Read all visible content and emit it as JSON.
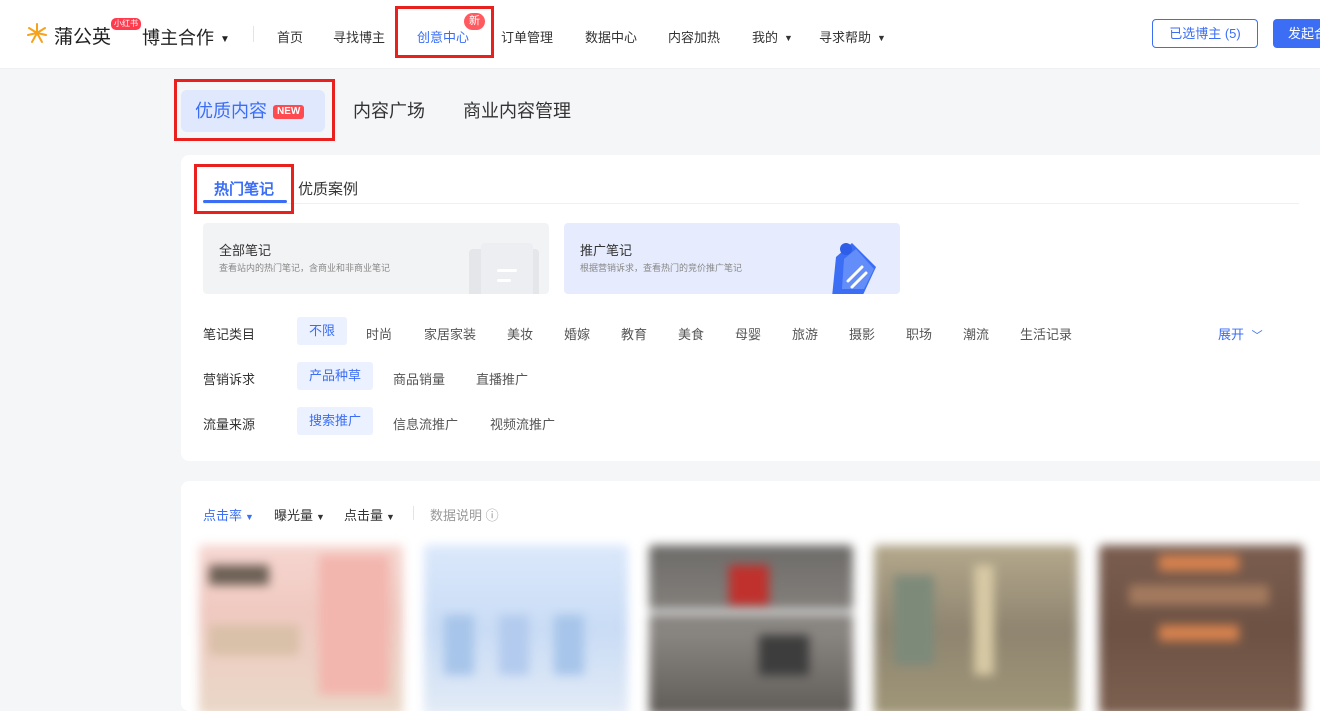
{
  "topnav": {
    "logo_text": "蒲公英",
    "logo_badge": "小红书",
    "product": "博主合作",
    "items": [
      {
        "label": "首页"
      },
      {
        "label": "寻找博主"
      },
      {
        "label": "创意中心",
        "badge": "新"
      },
      {
        "label": "订单管理"
      },
      {
        "label": "数据中心"
      },
      {
        "label": "内容加热"
      },
      {
        "label": "我的"
      },
      {
        "label": "寻求帮助"
      }
    ],
    "selected_btn": "已选博主 (5)",
    "publish_btn": "发起合作",
    "accent": "#3b6ef5"
  },
  "primary_tabs": [
    {
      "label": "优质内容",
      "badge": "NEW"
    },
    {
      "label": "内容广场"
    },
    {
      "label": "商业内容管理"
    }
  ],
  "sub_tabs": [
    {
      "label": "热门笔记"
    },
    {
      "label": "优质案例"
    }
  ],
  "type_cards": [
    {
      "title": "全部笔记",
      "desc": "查看站内的热门笔记，含商业和非商业笔记"
    },
    {
      "title": "推广笔记",
      "desc": "根据营销诉求，查看热门的竞价推广笔记"
    }
  ],
  "filters": {
    "category": {
      "label": "笔记类目",
      "options": [
        "不限",
        "时尚",
        "家居家装",
        "美妆",
        "婚嫁",
        "教育",
        "美食",
        "母婴",
        "旅游",
        "摄影",
        "职场",
        "潮流",
        "生活记录"
      ],
      "selected": "不限",
      "expand": "展开"
    },
    "marketing": {
      "label": "营销诉求",
      "options": [
        "产品种草",
        "商品销量",
        "直播推广"
      ],
      "selected": "产品种草"
    },
    "traffic": {
      "label": "流量来源",
      "options": [
        "搜索推广",
        "信息流推广",
        "视频流推广"
      ],
      "selected": "搜索推广"
    }
  },
  "sort": {
    "options": [
      "点击率",
      "曝光量",
      "点击量"
    ],
    "selected": "点击率",
    "data_note": "数据说明 ⓘ"
  },
  "annotation_color": "#e8201e"
}
